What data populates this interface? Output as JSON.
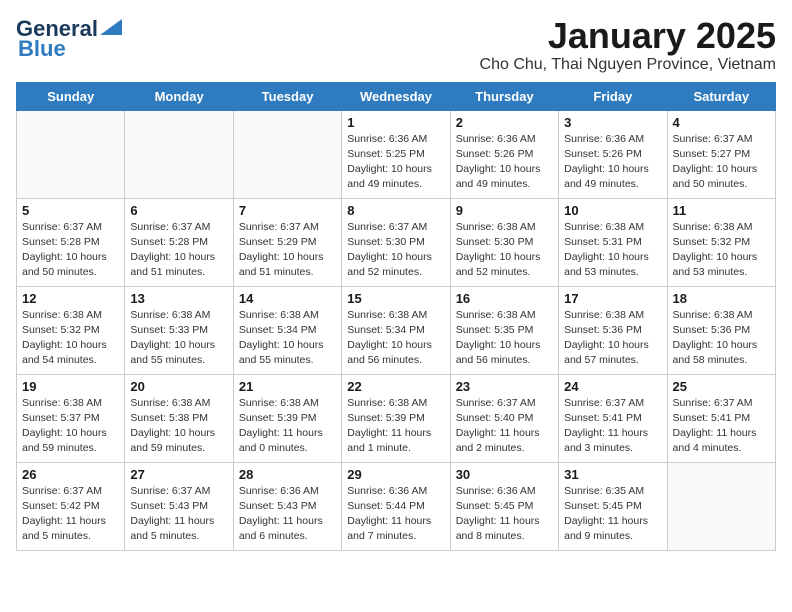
{
  "logo": {
    "general": "General",
    "blue": "Blue"
  },
  "title": "January 2025",
  "subtitle": "Cho Chu, Thai Nguyen Province, Vietnam",
  "weekdays": [
    "Sunday",
    "Monday",
    "Tuesday",
    "Wednesday",
    "Thursday",
    "Friday",
    "Saturday"
  ],
  "weeks": [
    [
      {
        "day": "",
        "info": ""
      },
      {
        "day": "",
        "info": ""
      },
      {
        "day": "",
        "info": ""
      },
      {
        "day": "1",
        "info": "Sunrise: 6:36 AM\nSunset: 5:25 PM\nDaylight: 10 hours and 49 minutes."
      },
      {
        "day": "2",
        "info": "Sunrise: 6:36 AM\nSunset: 5:26 PM\nDaylight: 10 hours and 49 minutes."
      },
      {
        "day": "3",
        "info": "Sunrise: 6:36 AM\nSunset: 5:26 PM\nDaylight: 10 hours and 49 minutes."
      },
      {
        "day": "4",
        "info": "Sunrise: 6:37 AM\nSunset: 5:27 PM\nDaylight: 10 hours and 50 minutes."
      }
    ],
    [
      {
        "day": "5",
        "info": "Sunrise: 6:37 AM\nSunset: 5:28 PM\nDaylight: 10 hours and 50 minutes."
      },
      {
        "day": "6",
        "info": "Sunrise: 6:37 AM\nSunset: 5:28 PM\nDaylight: 10 hours and 51 minutes."
      },
      {
        "day": "7",
        "info": "Sunrise: 6:37 AM\nSunset: 5:29 PM\nDaylight: 10 hours and 51 minutes."
      },
      {
        "day": "8",
        "info": "Sunrise: 6:37 AM\nSunset: 5:30 PM\nDaylight: 10 hours and 52 minutes."
      },
      {
        "day": "9",
        "info": "Sunrise: 6:38 AM\nSunset: 5:30 PM\nDaylight: 10 hours and 52 minutes."
      },
      {
        "day": "10",
        "info": "Sunrise: 6:38 AM\nSunset: 5:31 PM\nDaylight: 10 hours and 53 minutes."
      },
      {
        "day": "11",
        "info": "Sunrise: 6:38 AM\nSunset: 5:32 PM\nDaylight: 10 hours and 53 minutes."
      }
    ],
    [
      {
        "day": "12",
        "info": "Sunrise: 6:38 AM\nSunset: 5:32 PM\nDaylight: 10 hours and 54 minutes."
      },
      {
        "day": "13",
        "info": "Sunrise: 6:38 AM\nSunset: 5:33 PM\nDaylight: 10 hours and 55 minutes."
      },
      {
        "day": "14",
        "info": "Sunrise: 6:38 AM\nSunset: 5:34 PM\nDaylight: 10 hours and 55 minutes."
      },
      {
        "day": "15",
        "info": "Sunrise: 6:38 AM\nSunset: 5:34 PM\nDaylight: 10 hours and 56 minutes."
      },
      {
        "day": "16",
        "info": "Sunrise: 6:38 AM\nSunset: 5:35 PM\nDaylight: 10 hours and 56 minutes."
      },
      {
        "day": "17",
        "info": "Sunrise: 6:38 AM\nSunset: 5:36 PM\nDaylight: 10 hours and 57 minutes."
      },
      {
        "day": "18",
        "info": "Sunrise: 6:38 AM\nSunset: 5:36 PM\nDaylight: 10 hours and 58 minutes."
      }
    ],
    [
      {
        "day": "19",
        "info": "Sunrise: 6:38 AM\nSunset: 5:37 PM\nDaylight: 10 hours and 59 minutes."
      },
      {
        "day": "20",
        "info": "Sunrise: 6:38 AM\nSunset: 5:38 PM\nDaylight: 10 hours and 59 minutes."
      },
      {
        "day": "21",
        "info": "Sunrise: 6:38 AM\nSunset: 5:39 PM\nDaylight: 11 hours and 0 minutes."
      },
      {
        "day": "22",
        "info": "Sunrise: 6:38 AM\nSunset: 5:39 PM\nDaylight: 11 hours and 1 minute."
      },
      {
        "day": "23",
        "info": "Sunrise: 6:37 AM\nSunset: 5:40 PM\nDaylight: 11 hours and 2 minutes."
      },
      {
        "day": "24",
        "info": "Sunrise: 6:37 AM\nSunset: 5:41 PM\nDaylight: 11 hours and 3 minutes."
      },
      {
        "day": "25",
        "info": "Sunrise: 6:37 AM\nSunset: 5:41 PM\nDaylight: 11 hours and 4 minutes."
      }
    ],
    [
      {
        "day": "26",
        "info": "Sunrise: 6:37 AM\nSunset: 5:42 PM\nDaylight: 11 hours and 5 minutes."
      },
      {
        "day": "27",
        "info": "Sunrise: 6:37 AM\nSunset: 5:43 PM\nDaylight: 11 hours and 5 minutes."
      },
      {
        "day": "28",
        "info": "Sunrise: 6:36 AM\nSunset: 5:43 PM\nDaylight: 11 hours and 6 minutes."
      },
      {
        "day": "29",
        "info": "Sunrise: 6:36 AM\nSunset: 5:44 PM\nDaylight: 11 hours and 7 minutes."
      },
      {
        "day": "30",
        "info": "Sunrise: 6:36 AM\nSunset: 5:45 PM\nDaylight: 11 hours and 8 minutes."
      },
      {
        "day": "31",
        "info": "Sunrise: 6:35 AM\nSunset: 5:45 PM\nDaylight: 11 hours and 9 minutes."
      },
      {
        "day": "",
        "info": ""
      }
    ]
  ]
}
